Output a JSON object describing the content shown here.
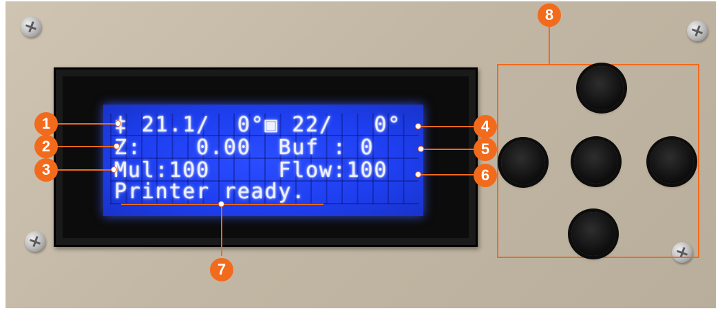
{
  "lcd": {
    "line1": "‡ 21.1/  0°▣ 22/   0°",
    "line2": "Z:    0.00  Buf : 0",
    "line3": "Mul:100     Flow:100",
    "line4": "Printer ready."
  },
  "callouts": [
    "1",
    "2",
    "3",
    "4",
    "5",
    "6",
    "7",
    "8"
  ],
  "buttons": {
    "up": "up-button",
    "left": "left-button",
    "center": "center-button",
    "right": "right-button",
    "down": "down-button"
  },
  "colors": {
    "accent": "#f26a1b",
    "lcd_background": "#1e3ff0",
    "lcd_text": "#eef2ff",
    "panel": "#c7bca9"
  }
}
